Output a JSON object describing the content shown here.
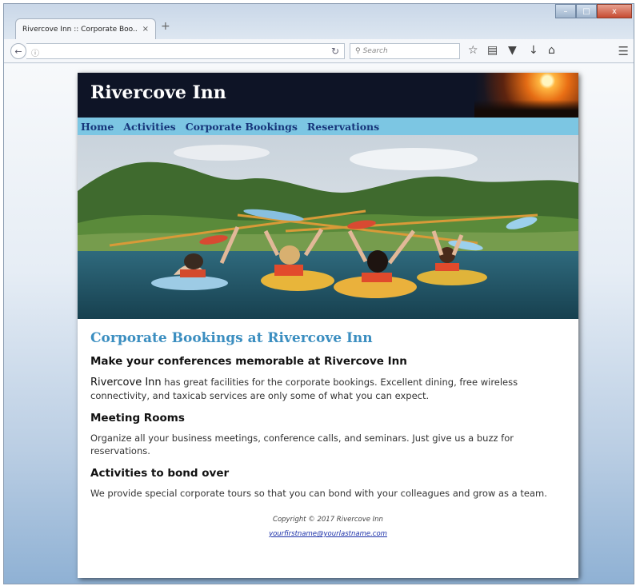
{
  "browser": {
    "tab_title": "Rivercove Inn :: Corporate Boo...",
    "tab_close": "×",
    "new_tab": "+",
    "win_min": "–",
    "win_max": "□",
    "win_close": "x",
    "search_placeholder": "Search",
    "icons": [
      "back-arrow-icon",
      "info-icon",
      "reload-icon",
      "search-icon",
      "bookmark-star-icon",
      "reading-list-icon",
      "pocket-icon",
      "download-icon",
      "home-icon",
      "menu-icon"
    ]
  },
  "site": {
    "title": "Rivercove Inn",
    "nav": [
      {
        "label": "Home"
      },
      {
        "label": "Activities"
      },
      {
        "label": "Corporate Bookings"
      },
      {
        "label": "Reservations"
      }
    ],
    "colors": {
      "header_bg": "#0e1426",
      "nav_bg": "#7cc6e3",
      "nav_link": "#16357a",
      "heading_accent": "#3b8ec0"
    }
  },
  "content": {
    "main_heading": "Corporate Bookings at Rivercove Inn",
    "sub_heading": "Make your conferences memorable at Rivercove Inn",
    "intro_brand": "Rivercove Inn",
    "intro_text": " has great facilities for the corporate bookings. Excellent dining, free wireless connectivity, and taxicab services are only some of what you can expect.",
    "sections": [
      {
        "heading": "Meeting Rooms",
        "text": "Organize all your business meetings, conference calls, and seminars. Just give us a buzz for reservations."
      },
      {
        "heading": "Activities to bond over",
        "text": "We provide special corporate tours so that you can bond with your colleagues and grow as a team."
      }
    ]
  },
  "footer": {
    "copyright": "Copyright © 2017 Rivercove Inn",
    "email": "yourfirstname@yourlastname.com"
  }
}
